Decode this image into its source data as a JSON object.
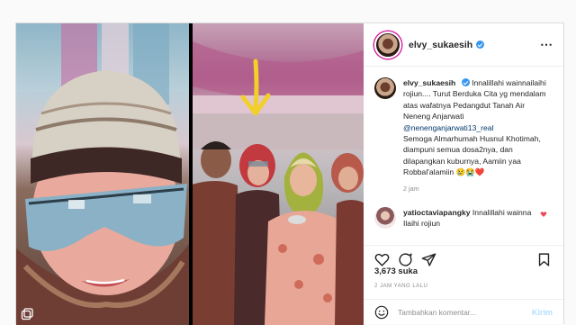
{
  "post": {
    "username": "elvy_sukaesih",
    "caption_username": "elvy_sukaesih",
    "caption_text": "Innalillahi wainnailaihi rojiun.... Turut Berduka Cita yg mendalam atas wafatnya Pedangdut Tanah Air Neneng Anjarwati",
    "caption_mention": "@nenenganjarwati13_real",
    "caption_text2": "Semoga Almarhumah Husnul Khotimah, diampuni semua dosa2nya, dan dilapangkan kuburnya, Aamiin yaa Robbal'alamiin",
    "caption_emoji": "😢😭❤️",
    "caption_time": "2 jam",
    "comment_username": "yatioctaviapangky",
    "comment_text": "Innalillahi wainna Ilaihi rojiun",
    "likes": "3,673 suka",
    "date": "2 JAM YANG LALU",
    "comment_placeholder": "Tambahkan komentar...",
    "post_button": "Kirim",
    "more_icon": "⋯"
  },
  "colors": {
    "verified": "#3897f0",
    "mention": "#00376b",
    "heart": "#ed4956",
    "post_button": "#b2dffc"
  },
  "icons": [
    "verified-badge-icon",
    "more-options-icon",
    "heart-icon",
    "comment-icon",
    "share-icon",
    "save-icon",
    "emoji-icon",
    "multi-photo-icon",
    "down-arrow-icon"
  ]
}
